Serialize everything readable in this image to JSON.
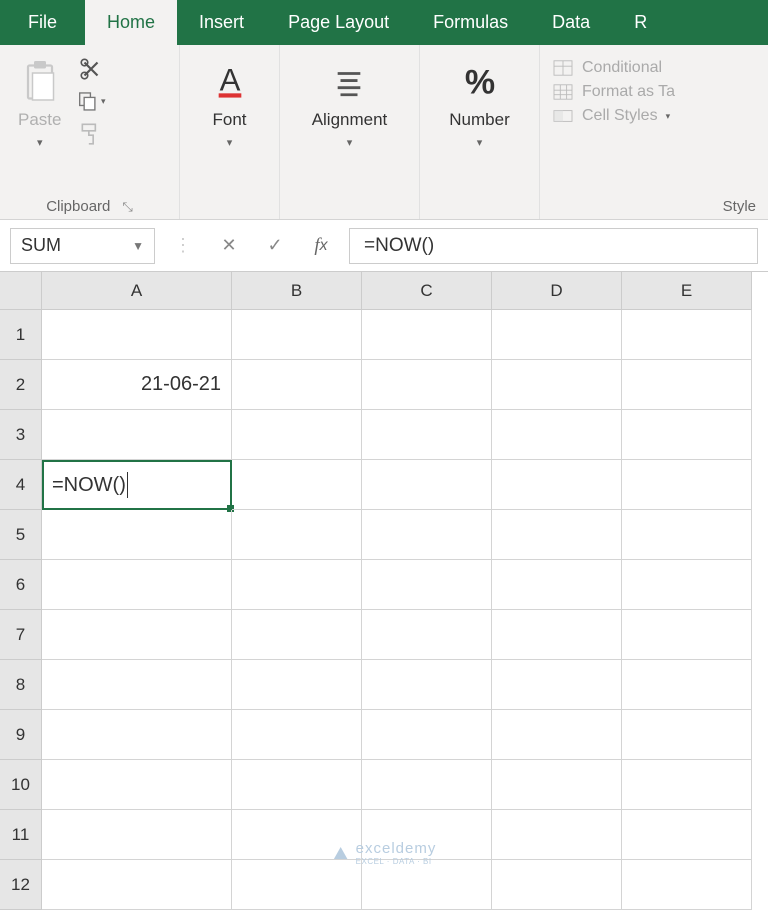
{
  "tabs": {
    "file": "File",
    "home": "Home",
    "insert": "Insert",
    "page_layout": "Page Layout",
    "formulas": "Formulas",
    "data": "Data",
    "r": "R"
  },
  "ribbon": {
    "clipboard": {
      "paste": "Paste",
      "label": "Clipboard"
    },
    "font": {
      "label": "Font"
    },
    "alignment": {
      "label": "Alignment"
    },
    "number": {
      "label": "Number"
    },
    "styles": {
      "conditional": "Conditional",
      "format_table": "Format as Ta",
      "cell_styles": "Cell Styles",
      "label": "Style"
    }
  },
  "formula_bar": {
    "name_box": "SUM",
    "formula": "=NOW()"
  },
  "columns": [
    "A",
    "B",
    "C",
    "D",
    "E"
  ],
  "row_numbers": [
    "1",
    "2",
    "3",
    "4",
    "5",
    "6",
    "7",
    "8",
    "9",
    "10",
    "11",
    "12"
  ],
  "cells": {
    "A2": "21-06-21",
    "A4": "=NOW()"
  },
  "watermark": {
    "text": "exceldemy",
    "sub": "EXCEL · DATA · BI"
  }
}
